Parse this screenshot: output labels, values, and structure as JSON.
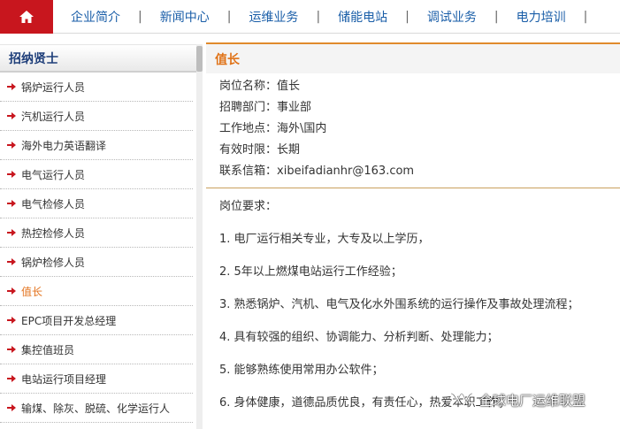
{
  "nav": {
    "home_icon": "home-icon",
    "items": [
      "企业简介",
      "新闻中心",
      "运维业务",
      "储能电站",
      "调试业务",
      "电力培训"
    ],
    "separator": "|"
  },
  "sidebar": {
    "title": "招纳贤士",
    "items": [
      {
        "label": "锅炉运行人员",
        "active": false
      },
      {
        "label": "汽机运行人员",
        "active": false
      },
      {
        "label": "海外电力英语翻译",
        "active": false
      },
      {
        "label": "电气运行人员",
        "active": false
      },
      {
        "label": "电气检修人员",
        "active": false
      },
      {
        "label": "热控检修人员",
        "active": false
      },
      {
        "label": "锅炉检修人员",
        "active": false
      },
      {
        "label": "值长",
        "active": true
      },
      {
        "label": "EPC项目开发总经理",
        "active": false
      },
      {
        "label": "集控值班员",
        "active": false
      },
      {
        "label": "电站运行项目经理",
        "active": false
      },
      {
        "label": "输煤、除灰、脱硫、化学运行人",
        "active": false
      }
    ],
    "accent_color": "#e3721c",
    "arrow_color": "#c8161e"
  },
  "main": {
    "title": "值长",
    "info": [
      {
        "label": "岗位名称：",
        "value": "值长"
      },
      {
        "label": "招聘部门：",
        "value": "事业部"
      },
      {
        "label": "工作地点：",
        "value": "海外\\国内"
      },
      {
        "label": "有效时限：",
        "value": "长期"
      },
      {
        "label": "联系信箱：",
        "value": "xibeifadianhr@163.com"
      }
    ],
    "requirements_title": "岗位要求：",
    "requirements": [
      "1. 电厂运行相关专业，大专及以上学历，",
      "2. 5年以上燃煤电站运行工作经验；",
      "3. 熟悉锅炉、汽机、电气及化水外围系统的运行操作及事故处理流程；",
      "4. 具有较强的组织、协调能力、分析判断、处理能力；",
      "5. 能够熟练使用常用办公软件；",
      "6. 身体健康，道德品质优良，有责任心，热爱本职工作；"
    ]
  },
  "watermark": {
    "text": "全球电厂运维联盟",
    "icon": "wechat-channel-icon"
  },
  "colors": {
    "brand_red": "#c8161e",
    "nav_blue": "#1a5ea8",
    "title_orange": "#e07318",
    "divider_gold": "#c9a15e"
  }
}
